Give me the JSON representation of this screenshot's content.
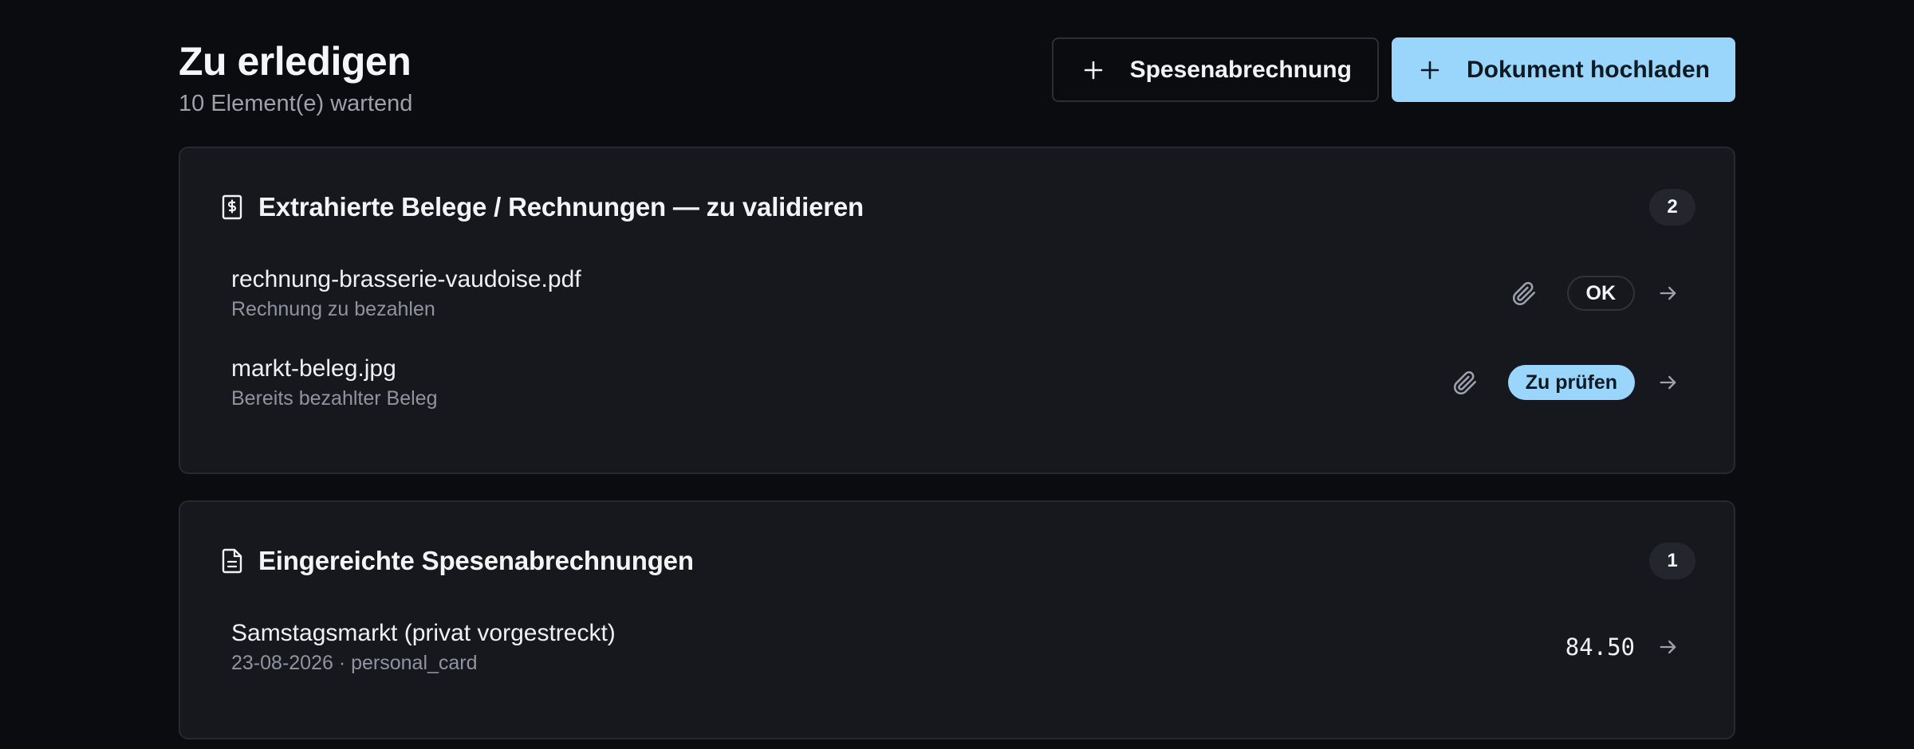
{
  "header": {
    "title": "Zu erledigen",
    "subtitle": "10 Element(e) wartend",
    "expense_button_label": "Spesenabrechnung",
    "upload_button_label": "Dokument hochladen"
  },
  "sections": [
    {
      "icon": "receipt-icon",
      "title": "Extrahierte Belege / Rechnungen — zu validieren",
      "count": "2",
      "items": [
        {
          "title": "rechnung-brasserie-vaudoise.pdf",
          "subtitle": "Rechnung zu bezahlen",
          "status": "OK"
        },
        {
          "title": "markt-beleg.jpg",
          "subtitle": "Bereits bezahlter Beleg",
          "status": "Zu prüfen"
        }
      ]
    },
    {
      "icon": "document-icon",
      "title": "Eingereichte Spesenabrechnungen",
      "count": "1",
      "items": [
        {
          "title": "Samstagsmarkt (privat vorgestreckt)",
          "subtitle": "23-08-2026 · personal_card",
          "amount": "84.50"
        }
      ]
    }
  ],
  "colors": {
    "background": "#0b0c10",
    "card": "#16181e",
    "accent": "#9ad6fb",
    "muted_text": "#8f949e"
  }
}
